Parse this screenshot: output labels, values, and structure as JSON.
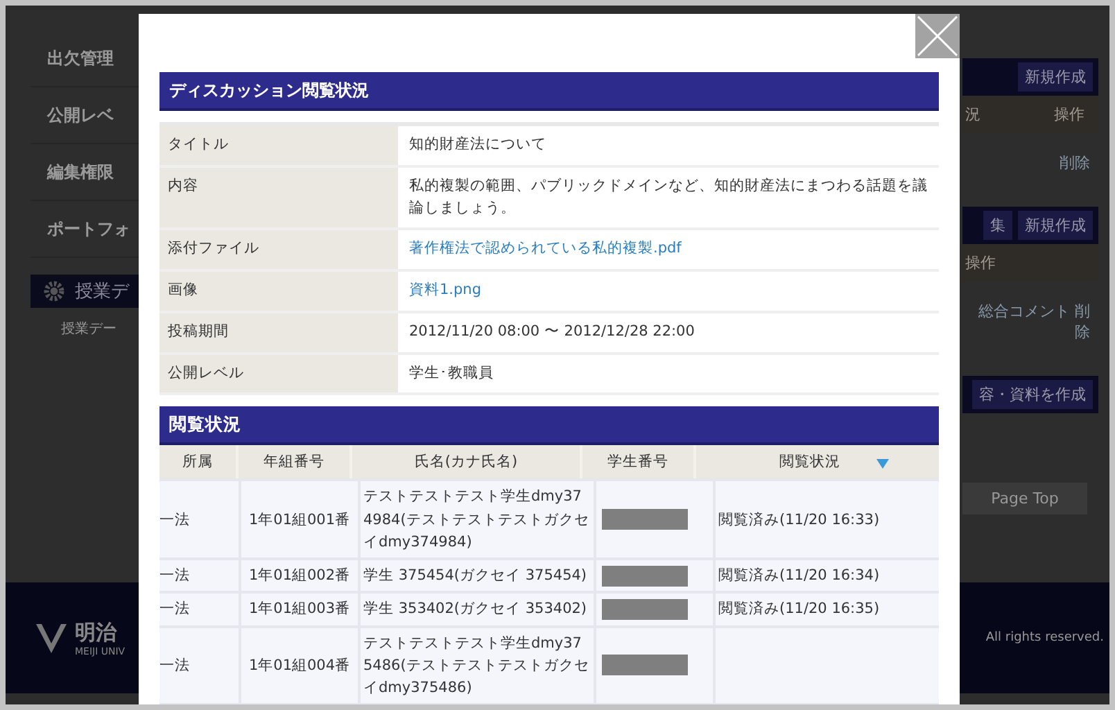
{
  "background_page": {
    "sidebar_items": [
      "出欠管理",
      "公開レベ",
      "編集権限",
      "ポートフォ"
    ],
    "sidebar_section": {
      "title": "授業デ",
      "items": [
        "授業デー"
      ]
    },
    "right_panels": [
      {
        "buttons": [
          "新規作成"
        ],
        "columns": [
          "況",
          "操作"
        ],
        "cells": [
          "削除"
        ]
      },
      {
        "buttons": [
          "集",
          "新規作成"
        ],
        "columns": [
          "操作"
        ],
        "cells": [
          "総合コメント 削除"
        ]
      },
      {
        "buttons": [
          "容・資料を作成"
        ]
      }
    ],
    "page_top": "Page Top",
    "footer": {
      "logo_text": "明治",
      "logo_subtext": "MEIJI UNIV",
      "copyright": "All rights reserved."
    }
  },
  "modal": {
    "title": "ディスカッション閲覧状況",
    "details": [
      {
        "label": "タイトル",
        "value": "知的財産法について",
        "kind": "text"
      },
      {
        "label": "内容",
        "value": "私的複製の範囲、パブリックドメインなど、知的財産法にまつわる話題を議論しましょう。",
        "kind": "text"
      },
      {
        "label": "添付ファイル",
        "value": "著作権法で認められている私的複製.pdf",
        "kind": "link"
      },
      {
        "label": "画像",
        "value": "資料1.png",
        "kind": "link"
      },
      {
        "label": "投稿期間",
        "value": "2012/11/20 08:00 〜 2012/12/28 22:00",
        "kind": "text"
      },
      {
        "label": "公開レベル",
        "value": "学生･教職員",
        "kind": "text"
      }
    ],
    "status_section": {
      "title": "閲覧状況",
      "columns": [
        {
          "label": "所属",
          "sorted": false
        },
        {
          "label": "年組番号",
          "sorted": false
        },
        {
          "label": "氏名(カナ氏名)",
          "sorted": false
        },
        {
          "label": "学生番号",
          "sorted": false
        },
        {
          "label": "閲覧状況",
          "sorted": true
        }
      ],
      "rows": [
        {
          "affiliation": "一法",
          "class_number": "1年01組001番",
          "name": "テストテストテスト学生dmy374984(テストテストテストガクセイdmy374984)",
          "status": "閲覧済み(11/20 16:33)"
        },
        {
          "affiliation": "一法",
          "class_number": "1年01組002番",
          "name": "学生 375454(ガクセイ 375454)",
          "status": "閲覧済み(11/20 16:34)"
        },
        {
          "affiliation": "一法",
          "class_number": "1年01組003番",
          "name": "学生 353402(ガクセイ 353402)",
          "status": "閲覧済み(11/20 16:35)"
        },
        {
          "affiliation": "一法",
          "class_number": "1年01組004番",
          "name": "テストテストテスト学生dmy375486(テストテストテストガクセイdmy375486)"
        }
      ]
    }
  }
}
